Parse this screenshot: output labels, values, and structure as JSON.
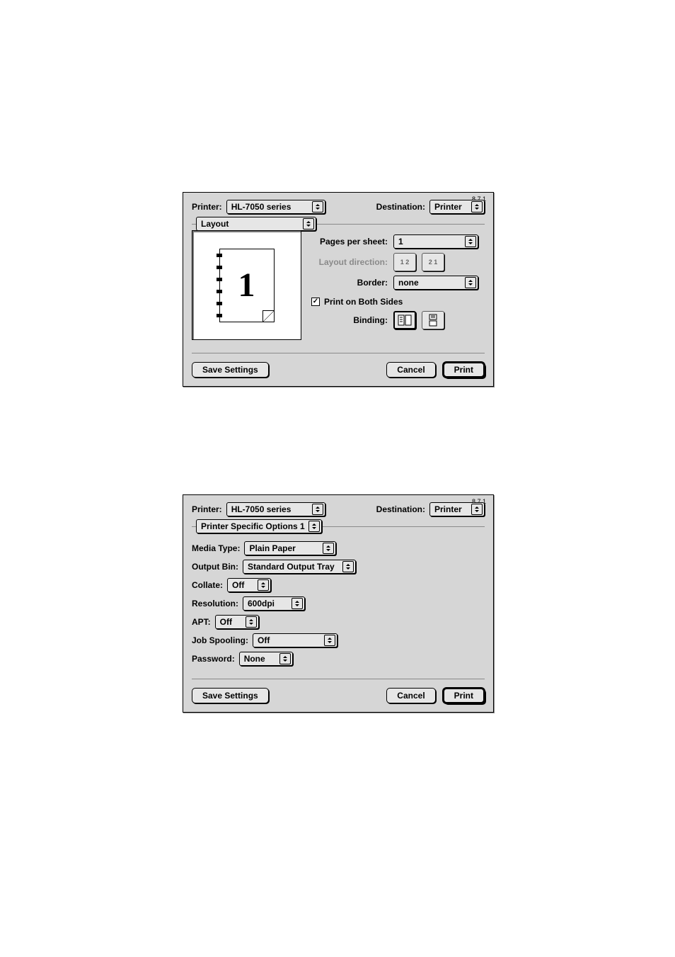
{
  "version": "8.7.1",
  "common": {
    "printer_label": "Printer:",
    "printer_value": "HL-7050 series",
    "destination_label": "Destination:",
    "destination_value": "Printer",
    "save_settings": "Save Settings",
    "cancel": "Cancel",
    "print": "Print"
  },
  "dialog1": {
    "section": "Layout",
    "preview_number": "1",
    "pages_per_sheet_label": "Pages per sheet:",
    "pages_per_sheet_value": "1",
    "layout_direction_label": "Layout direction:",
    "dir_option_a": "1 2",
    "dir_option_b": "2 1",
    "border_label": "Border:",
    "border_value": "none",
    "print_both_sides_label": "Print on Both Sides",
    "print_both_sides_checked": true,
    "binding_label": "Binding:"
  },
  "dialog2": {
    "section": "Printer Specific Options 1",
    "media_type_label": "Media Type:",
    "media_type_value": "Plain Paper",
    "output_bin_label": "Output Bin:",
    "output_bin_value": "Standard Output Tray",
    "collate_label": "Collate:",
    "collate_value": "Off",
    "resolution_label": "Resolution:",
    "resolution_value": "600dpi",
    "apt_label": "APT:",
    "apt_value": "Off",
    "job_spooling_label": "Job Spooling:",
    "job_spooling_value": "Off",
    "password_label": "Password:",
    "password_value": "None"
  }
}
